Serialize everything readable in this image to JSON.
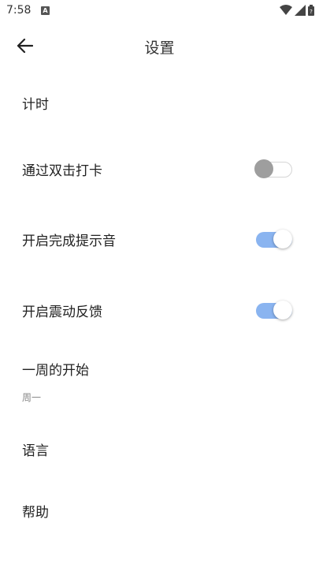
{
  "status_bar": {
    "time": "7:58",
    "notification_icon_letter": "A"
  },
  "header": {
    "title": "设置"
  },
  "settings": {
    "timer": {
      "label": "计时"
    },
    "double_tap_checkin": {
      "label": "通过双击打卡",
      "enabled": false
    },
    "completion_sound": {
      "label": "开启完成提示音",
      "enabled": true
    },
    "vibration_feedback": {
      "label": "开启震动反馈",
      "enabled": true
    },
    "week_start": {
      "label": "一周的开始",
      "value": "周一"
    },
    "language": {
      "label": "语言"
    },
    "help": {
      "label": "帮助"
    }
  },
  "colors": {
    "switch_on_track": "#8ab4f0",
    "switch_off_thumb": "#9e9e9e"
  }
}
